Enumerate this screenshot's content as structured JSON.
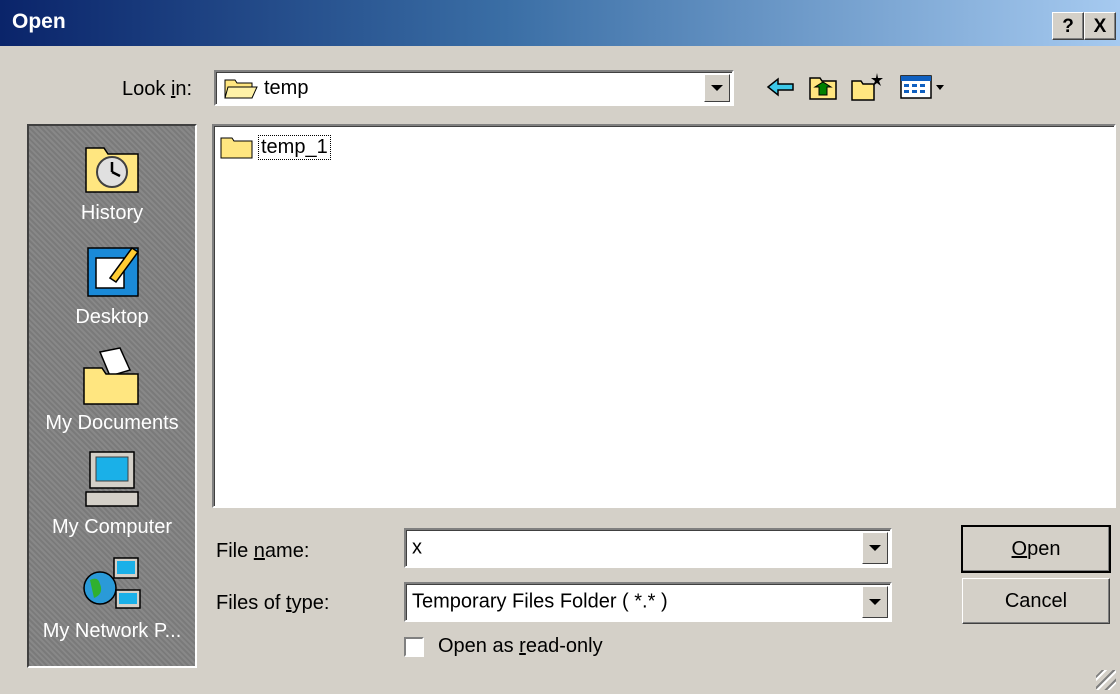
{
  "window": {
    "title": "Open",
    "help_glyph": "?",
    "close_glyph": "X"
  },
  "lookin": {
    "label_pre": "Look ",
    "label_ul": "i",
    "label_post": "n:",
    "value": "temp"
  },
  "places": [
    {
      "label": "History",
      "icon": "history-icon"
    },
    {
      "label": "Desktop",
      "icon": "desktop-icon"
    },
    {
      "label": "My Documents",
      "icon": "my-documents-icon"
    },
    {
      "label": "My Computer",
      "icon": "my-computer-icon"
    },
    {
      "label": "My Network P...",
      "icon": "my-network-places-icon"
    }
  ],
  "files": [
    {
      "name": "temp_1",
      "icon": "folder-icon"
    }
  ],
  "filename": {
    "label_pre": "File ",
    "label_ul": "n",
    "label_post": "ame:",
    "value": "x"
  },
  "filetype": {
    "label_pre": "Files of ",
    "label_ul": "t",
    "label_post": "ype:",
    "value": "Temporary Files Folder ( *.* )"
  },
  "readonly": {
    "label_pre": "Open as ",
    "label_ul": "r",
    "label_post": "ead-only",
    "checked": false
  },
  "buttons": {
    "open_ul": "O",
    "open_post": "pen",
    "cancel": "Cancel"
  }
}
